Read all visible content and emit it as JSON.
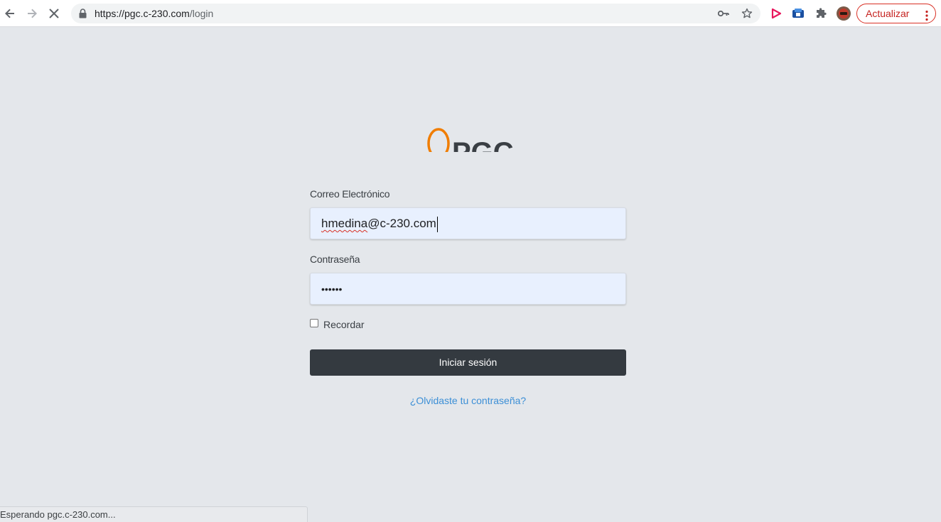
{
  "browser": {
    "url_host": "https://pgc.c-230.com",
    "url_path": "/login",
    "update_label": "Actualizar",
    "icons": [
      "back-icon",
      "forward-icon",
      "stop-loading-icon",
      "lock-icon",
      "key-icon",
      "star-icon",
      "extension-play-icon",
      "extension-cube-icon",
      "puzzle-icon",
      "profile-avatar"
    ],
    "status_text": "Esperando pgc.c-230.com..."
  },
  "login": {
    "logo_text": "PGC",
    "email_label": "Correo Electrónico",
    "email_value": "hmedina@c-230.com",
    "email_value_part1": "hmedina",
    "email_value_part2": "@c-230.com",
    "password_label": "Contraseña",
    "password_value": "••••••",
    "remember_label": "Recordar",
    "remember_checked": false,
    "submit_label": "Iniciar sesión",
    "forgot_link": "¿Olvidaste tu contraseña?"
  },
  "colors": {
    "page_bg": "#e4e7eb",
    "field_bg": "#e8f0fe",
    "button_bg": "#343a40",
    "link": "#3c8fd6",
    "logo_orange": "#f07d00",
    "logo_dark": "#3a3f44"
  }
}
